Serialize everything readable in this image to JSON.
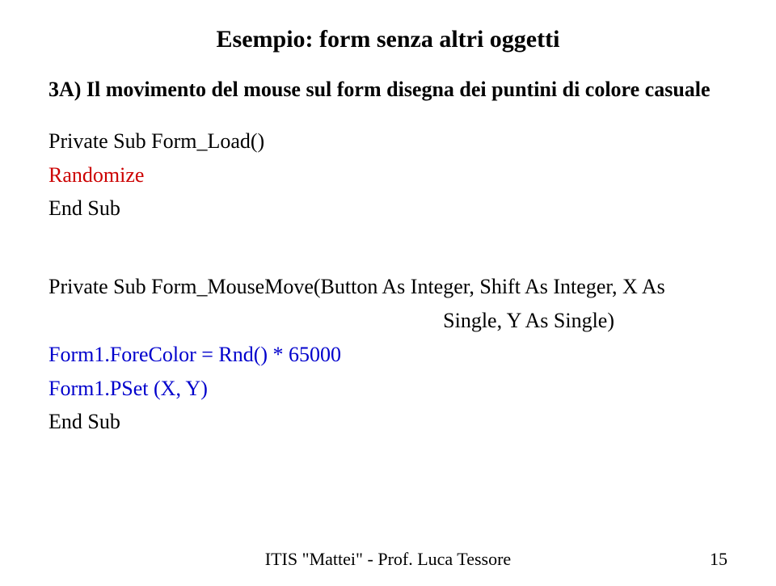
{
  "title": "Esempio: form senza altri oggetti",
  "subtitle": "3A) Il movimento del mouse sul form disegna dei puntini di colore casuale",
  "code": {
    "line1": "Private Sub Form_Load()",
    "line2": "Randomize",
    "line3": "End Sub",
    "line4": "Private Sub Form_MouseMove(Button As Integer, Shift As Integer, X As",
    "line5": "Single, Y As Single)",
    "line6": "Form1.ForeColor = Rnd() * 65000",
    "line7": "Form1.PSet (X, Y)",
    "line8": "End Sub"
  },
  "footer": {
    "text": "ITIS \"Mattei\"  -  Prof. Luca Tessore",
    "page": "15"
  }
}
